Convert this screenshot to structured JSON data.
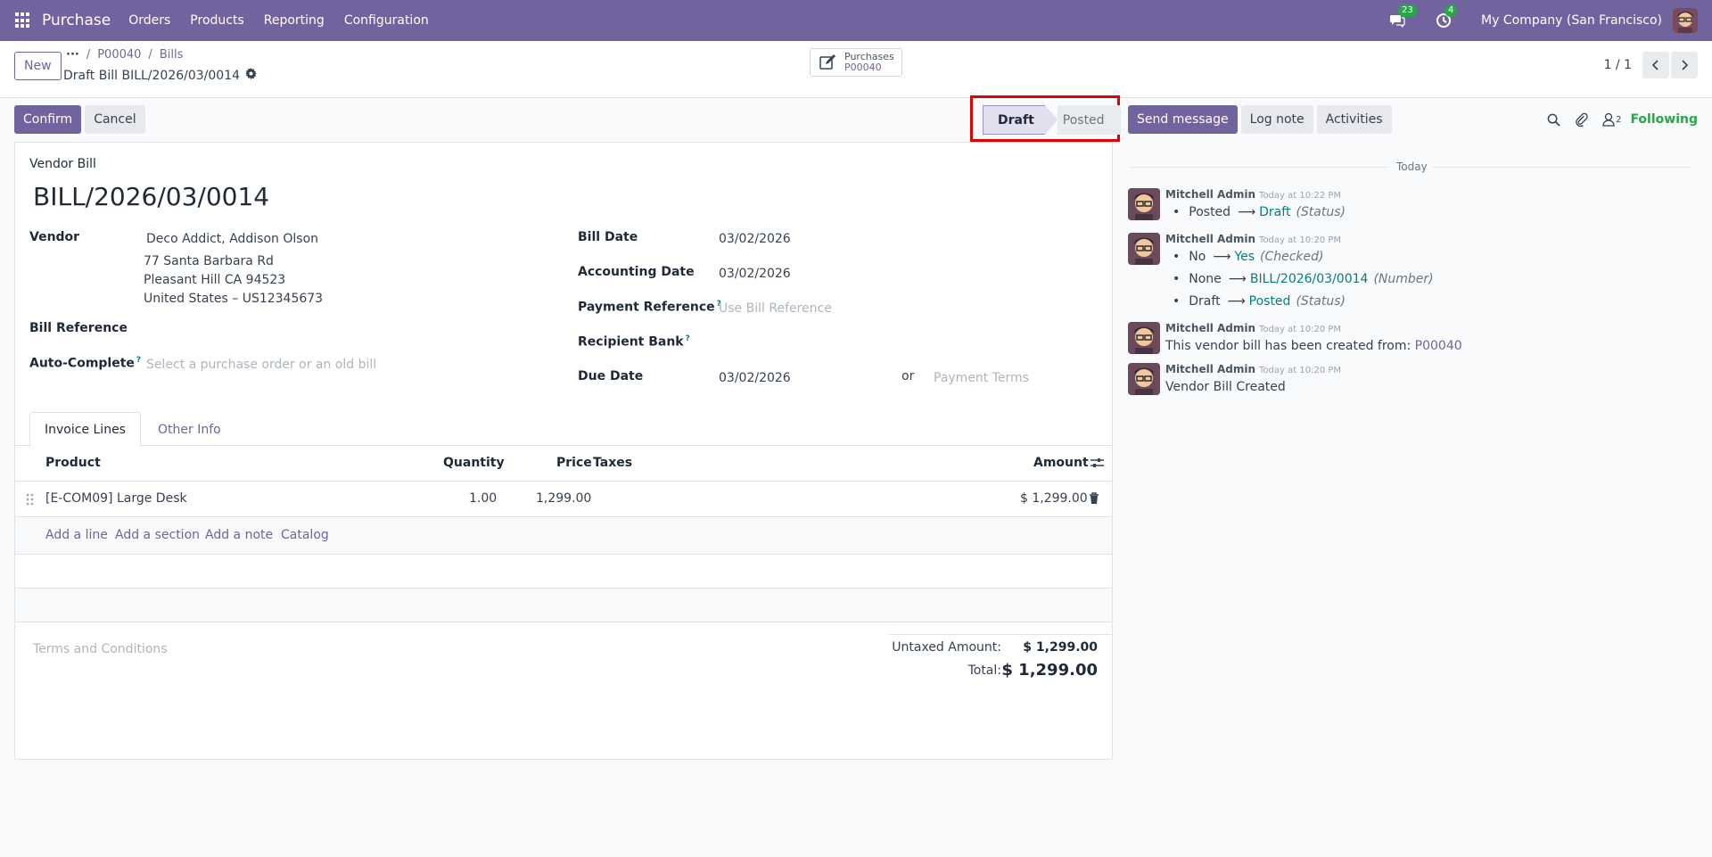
{
  "navbar": {
    "app_name": "Purchase",
    "menu": [
      "Orders",
      "Products",
      "Reporting",
      "Configuration"
    ],
    "messages_count": "23",
    "activities_count": "4",
    "company": "My Company (San Francisco)"
  },
  "control": {
    "new_label": "New",
    "breadcrumb": [
      "P00040",
      "Bills"
    ],
    "record_title": "Draft Bill BILL/2026/03/0014",
    "smart_button": {
      "label": "Purchases",
      "value": "P00040"
    },
    "pager": "1 / 1"
  },
  "actions": {
    "confirm": "Confirm",
    "cancel": "Cancel",
    "status_active": "Draft",
    "status_next": "Posted",
    "send_message": "Send message",
    "log_note": "Log note",
    "activities": "Activities",
    "followers_count": "2",
    "following": "Following"
  },
  "form": {
    "doc_type": "Vendor Bill",
    "doc_name": "BILL/2026/03/0014",
    "vendor_label": "Vendor",
    "vendor_name": "Deco Addict, Addison Olson",
    "vendor_address": [
      "77 Santa Barbara Rd",
      "Pleasant Hill CA 94523",
      "United States – US12345673"
    ],
    "bill_reference_label": "Bill Reference",
    "auto_complete_label": "Auto-Complete",
    "auto_complete_placeholder": "Select a purchase order or an old bill",
    "bill_date_label": "Bill Date",
    "bill_date": "03/02/2026",
    "accounting_date_label": "Accounting Date",
    "accounting_date": "03/02/2026",
    "payment_reference_label": "Payment Reference",
    "payment_reference_placeholder": "Use Bill Reference",
    "recipient_bank_label": "Recipient Bank",
    "due_date_label": "Due Date",
    "due_date": "03/02/2026",
    "or": "or",
    "payment_terms_placeholder": "Payment Terms",
    "help_mark": "?"
  },
  "tabs": [
    "Invoice Lines",
    "Other Info"
  ],
  "lines": {
    "headers": {
      "product": "Product",
      "quantity": "Quantity",
      "price": "Price",
      "taxes": "Taxes",
      "amount": "Amount"
    },
    "rows": [
      {
        "product": "[E-COM09] Large Desk",
        "quantity": "1.00",
        "price": "1,299.00",
        "taxes": "",
        "amount": "$ 1,299.00"
      }
    ],
    "add": [
      "Add a line",
      "Add a section",
      "Add a note",
      "Catalog"
    ]
  },
  "terms_placeholder": "Terms and Conditions",
  "totals": {
    "untaxed_label": "Untaxed Amount:",
    "untaxed_value": "$ 1,299.00",
    "total_label": "Total:",
    "total_value": "$ 1,299.00"
  },
  "chatter": {
    "today": "Today",
    "messages": [
      {
        "author": "Mitchell Admin",
        "time": "Today at 10:22 PM",
        "changes": [
          {
            "old": "Posted",
            "new": "Draft",
            "field": "(Status)"
          }
        ]
      },
      {
        "author": "Mitchell Admin",
        "time": "Today at 10:20 PM",
        "changes": [
          {
            "old": "No",
            "new": "Yes",
            "field": "(Checked)"
          },
          {
            "old": "None",
            "new": "BILL/2026/03/0014",
            "field": "(Number)"
          },
          {
            "old": "Draft",
            "new": "Posted",
            "field": "(Status)"
          }
        ]
      },
      {
        "author": "Mitchell Admin",
        "time": "Today at 10:20 PM",
        "body": "This vendor bill has been created from:",
        "link": "P00040"
      },
      {
        "author": "Mitchell Admin",
        "time": "Today at 10:20 PM",
        "body": "Vendor Bill Created"
      }
    ]
  },
  "colors": {
    "brand": "#71639e",
    "link": "#017e84",
    "success": "#28a745",
    "highlight": "#e00000"
  }
}
